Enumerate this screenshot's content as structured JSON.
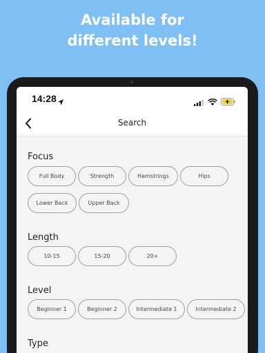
{
  "promo": {
    "line1": "Available for",
    "line2": "different levels!"
  },
  "status_bar": {
    "time": "14:28"
  },
  "nav": {
    "title": "Search"
  },
  "sections": {
    "focus": {
      "title": "Focus",
      "chips": [
        "Full Body",
        "Strength",
        "Hamstrings",
        "Hips",
        "Lower Back",
        "Upper Back"
      ]
    },
    "length": {
      "title": "Length",
      "chips": [
        "10-15",
        "15-20",
        "20+"
      ]
    },
    "level": {
      "title": "Level",
      "chips": [
        "Beginner 1",
        "Beginner 2",
        "Intermediate 1",
        "Intermediate 2"
      ]
    },
    "type": {
      "title": "Type"
    }
  },
  "colors": {
    "background": "#7fbff3",
    "device_frame": "#1b1b1d",
    "screen_bg": "#f4f4f4",
    "chip_border": "#9e9e9e",
    "battery_fill": "#f7d23b"
  }
}
